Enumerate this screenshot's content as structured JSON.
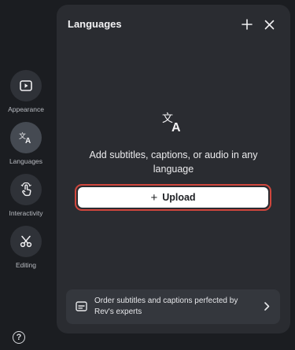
{
  "rail": {
    "items": [
      {
        "label": "Appearance",
        "icon": "play-icon"
      },
      {
        "label": "Languages",
        "icon": "translate-icon"
      },
      {
        "label": "Interactivity",
        "icon": "tap-icon"
      },
      {
        "label": "Editing",
        "icon": "scissors-icon"
      }
    ],
    "help_label": "?"
  },
  "panel": {
    "title": "Languages",
    "message": "Add subtitles, captions, or audio in any language",
    "upload_label": "Upload",
    "upload_plus": "+",
    "order_text": "Order subtitles and captions perfected by Rev's experts"
  },
  "colors": {
    "background": "#1b1d21",
    "panel": "#2a2c31",
    "highlight": "#d1473d"
  }
}
